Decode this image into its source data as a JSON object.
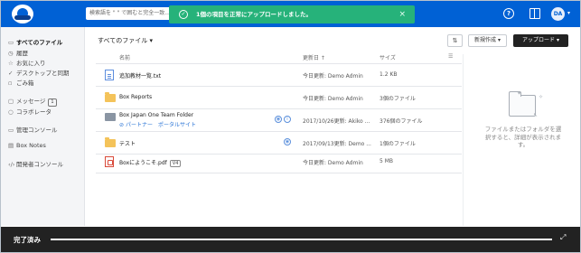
{
  "header": {
    "search_placeholder": "検索語を \" \" で囲むと完全一致...",
    "toast_message": "1個の項目を正常にアップロードしました。",
    "help_label": "?",
    "avatar_initials": "DA",
    "accent_color": "#0061d5",
    "toast_color": "#26b27a"
  },
  "sidebar": {
    "items": [
      {
        "label": "すべてのファイル",
        "icon": "folder-icon"
      },
      {
        "label": "履歴",
        "icon": "clock-icon"
      },
      {
        "label": "お気に入り",
        "icon": "star-icon"
      },
      {
        "label": "デスクトップと同期",
        "icon": "sync-icon"
      },
      {
        "label": "ごみ箱",
        "icon": "trash-icon"
      },
      {
        "label": "メッセージ",
        "icon": "message-icon",
        "badge": "1"
      },
      {
        "label": "コラボレータ",
        "icon": "user-icon"
      },
      {
        "label": "管理コンソール",
        "icon": "admin-icon"
      },
      {
        "label": "Box Notes",
        "icon": "notes-icon"
      },
      {
        "label": "開発者コンソール",
        "icon": "code-icon"
      }
    ]
  },
  "main": {
    "breadcrumb": "すべてのファイル ▾",
    "new_button": "新規作成 ▾",
    "upload_button": "アップロード ▾",
    "columns": {
      "name": "名前",
      "updated": "更新日 ↑",
      "size": "サイズ"
    },
    "rows": [
      {
        "name": "追加教材一覧.txt",
        "icon": "text-file-icon",
        "updated": "今日更新: Demo Admin",
        "size": "1.2 KB"
      },
      {
        "name": "Box Reports",
        "icon": "folder-icon",
        "updated": "今日更新: Demo Admin",
        "size": "3個のファイル"
      },
      {
        "name": "Box Japan One Team Folder",
        "sub": "パートナー　ポータルサイト",
        "icon": "external-folder-icon",
        "updated": "2017/10/26更新: Akiko ...",
        "size": "376個のファイル"
      },
      {
        "name": "テスト",
        "icon": "folder-icon",
        "updated": "2017/09/13更新: Demo ...",
        "size": "1個のファイル"
      },
      {
        "name": "Boxにようこそ.pdf",
        "version": "V4",
        "icon": "pdf-icon",
        "updated": "今日更新: Demo Admin",
        "size": "5 MB"
      }
    ]
  },
  "info_panel": {
    "text": "ファイルまたはフォルダを選択すると、詳細が表示されます。"
  },
  "footer": {
    "label": "完了済み",
    "progress": 1.0
  }
}
